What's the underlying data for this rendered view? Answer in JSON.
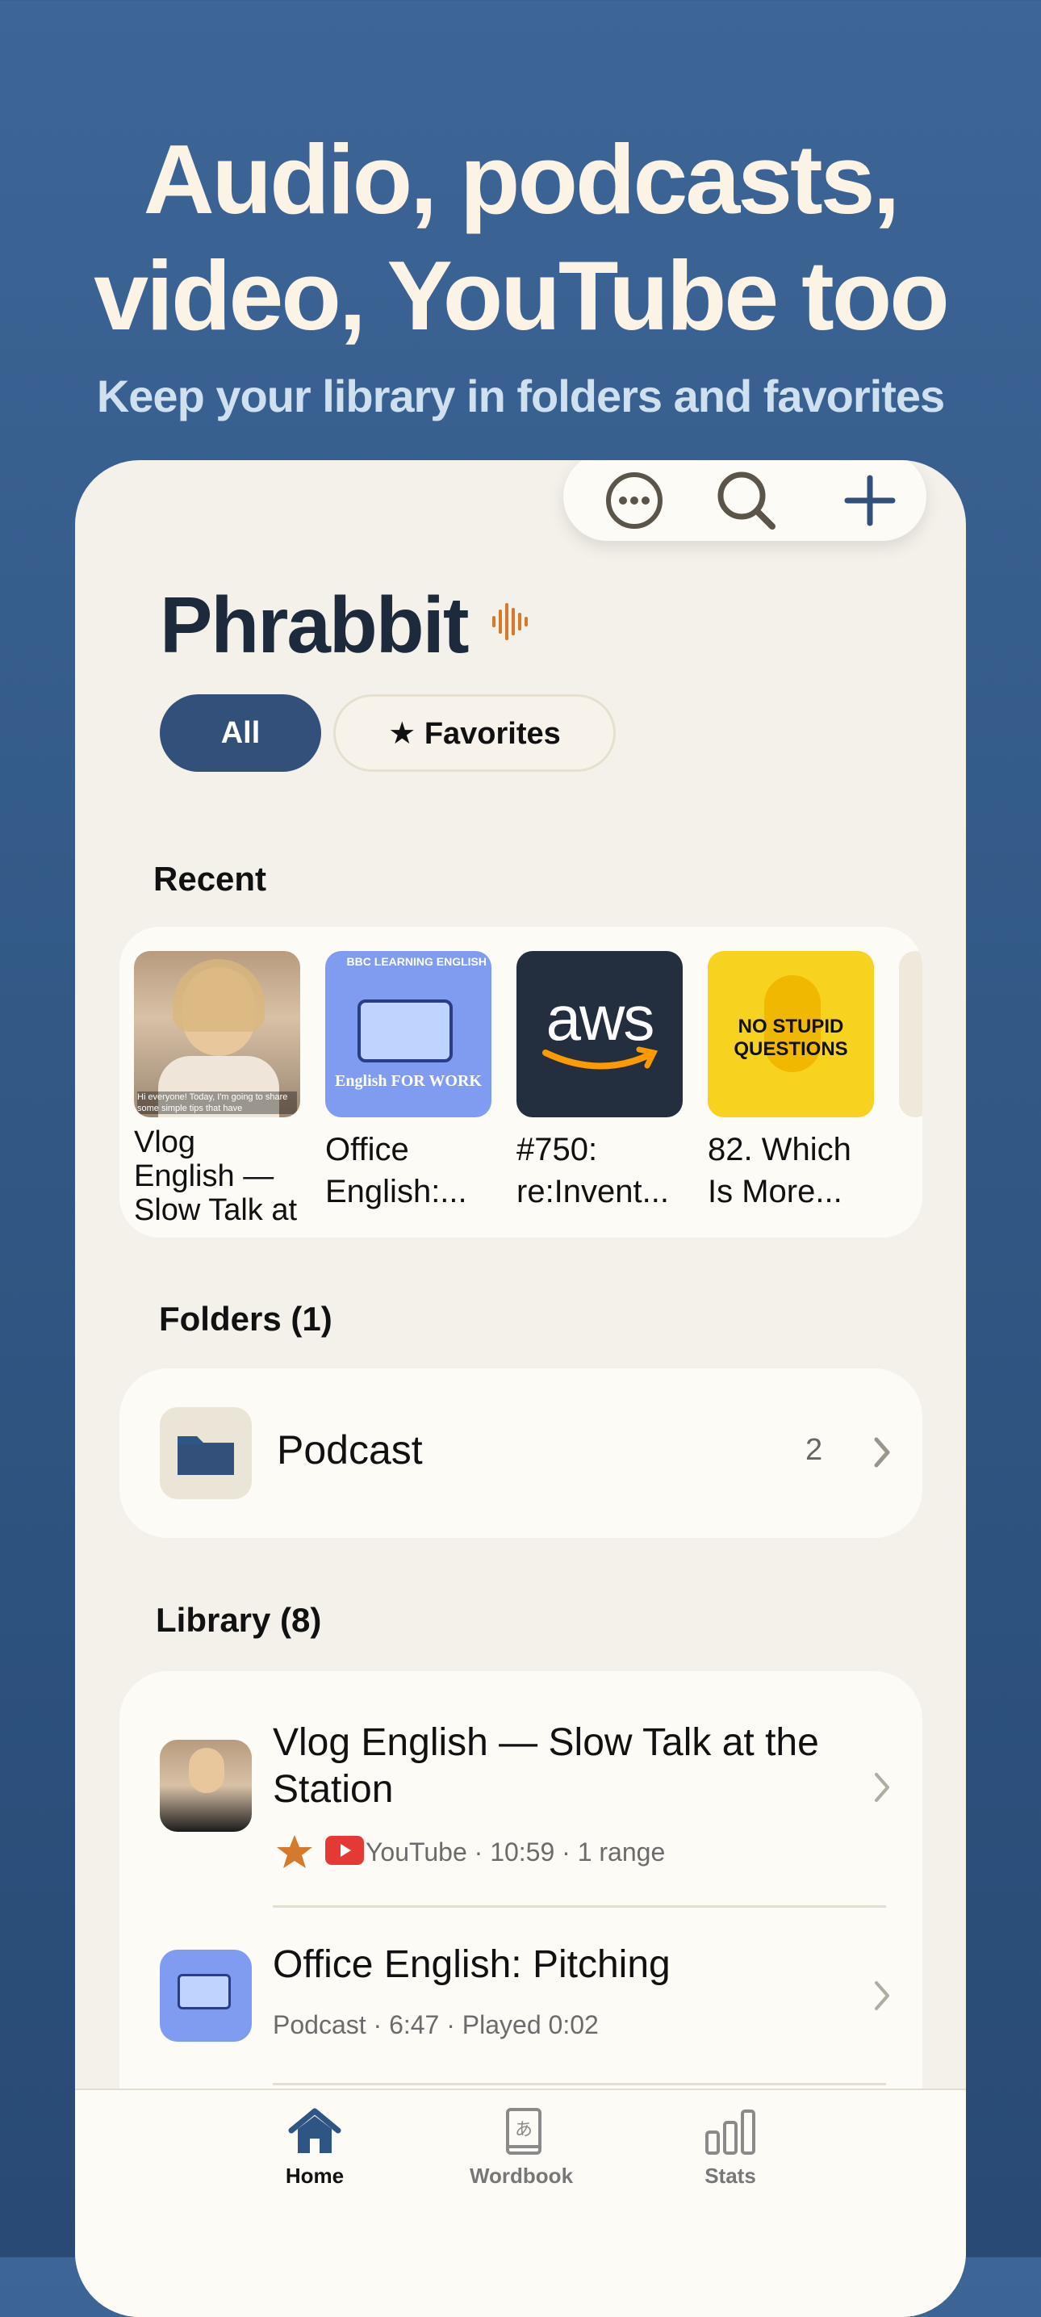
{
  "marketing": {
    "headline_line1": "Audio, podcasts,",
    "headline_line2": "video, YouTube too",
    "subheadline": "Keep your library in folders and favorites"
  },
  "toolbar": {
    "more_icon": "ellipsis-circle-icon",
    "search_icon": "magnifier-icon",
    "add_icon": "plus-icon"
  },
  "app": {
    "title": "Phrabbit",
    "logo_icon": "audio-wave-icon",
    "accent_color": "#d47a2a",
    "primary_color": "#33507a"
  },
  "filters": {
    "all_label": "All",
    "favorites_label": "★ Favorites"
  },
  "recent": {
    "title": "Recent",
    "items": [
      {
        "title": "Vlog English — Slow Talk at",
        "thumb_caption": "Hi everyone! Today, I'm going to share some simple tips that have"
      },
      {
        "title": "Office English:...",
        "thumb_brand": "BBC LEARNING ENGLISH",
        "thumb_text": "English FOR WORK"
      },
      {
        "title": "#750: re:Invent...",
        "thumb_text": "aws"
      },
      {
        "title": "82. Which Is More...",
        "thumb_text": "NO STUPID QUESTIONS"
      }
    ]
  },
  "folders": {
    "title": "Folders (1)",
    "items": [
      {
        "name": "Podcast",
        "count": "2"
      }
    ]
  },
  "library": {
    "title": "Library (8)",
    "items": [
      {
        "title_line1": "Vlog English — Slow Talk at the",
        "title_line2": "Station",
        "meta": "YouTube · 10:59 · 1 range",
        "favorite": true
      },
      {
        "title_line1": "Office English: Pitching",
        "meta": "Podcast · 6:47 · Played 0:02",
        "favorite": false
      }
    ]
  },
  "tabs": [
    {
      "label": "Home",
      "icon": "house-icon",
      "active": true
    },
    {
      "label": "Wordbook",
      "icon": "book-icon",
      "active": false
    },
    {
      "label": "Stats",
      "icon": "bar-chart-icon",
      "active": false
    }
  ]
}
